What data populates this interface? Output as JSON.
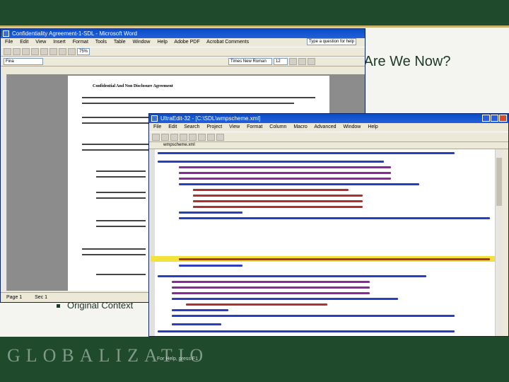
{
  "slide": {
    "title": "here Are We Now?",
    "bullet": "Original Context",
    "brand": "GLOBALIZATIO"
  },
  "word": {
    "title": "Confidentiality Agreement-1-SDL - Microsoft Word",
    "menu": [
      "File",
      "Edit",
      "View",
      "Insert",
      "Format",
      "Tools",
      "Table",
      "Window",
      "Help",
      "Adobe PDF",
      "Acrobat Comments"
    ],
    "style_combo": "Fina",
    "font_combo": "Times New Roman",
    "size_combo": "12",
    "zoom": "75%",
    "help_placeholder": "Type a question for help",
    "doc_heading": "Confidential And Non Disclosure Agreement",
    "status": {
      "page": "Page 1",
      "sec": "Sec 1"
    }
  },
  "xml": {
    "title": "UltraEdit-32 - [C:\\SDL\\wmpscheme.xml]",
    "menu": [
      "File",
      "Edit",
      "Search",
      "Project",
      "View",
      "Format",
      "Column",
      "Macro",
      "Advanced",
      "Window",
      "Help"
    ],
    "tab": "wmpscheme.xml",
    "status": "For Help, press F1"
  },
  "colors": {
    "slide_band": "#1f4a2c",
    "accent": "#c8b26a",
    "highlight": "#f4e23c"
  }
}
